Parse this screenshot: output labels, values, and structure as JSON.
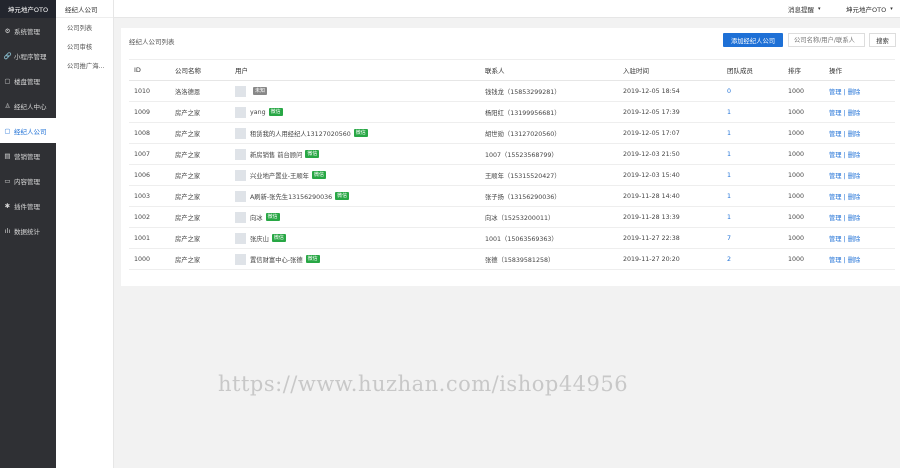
{
  "sidebar": {
    "brand": "坤元地产OTO",
    "items": [
      {
        "label": "系统管理",
        "icon": "gear-icon",
        "glyph": "⚙"
      },
      {
        "label": "小程序管理",
        "icon": "link-icon",
        "glyph": "🔗"
      },
      {
        "label": "楼盘管理",
        "icon": "building-icon",
        "glyph": "▢"
      },
      {
        "label": "经纪人中心",
        "icon": "user-icon",
        "glyph": "♙"
      },
      {
        "label": "经纪人公司",
        "icon": "company-icon",
        "glyph": "▢",
        "active": true
      },
      {
        "label": "营销管理",
        "icon": "marketing-icon",
        "glyph": "▤"
      },
      {
        "label": "内容管理",
        "icon": "content-icon",
        "glyph": "▭"
      },
      {
        "label": "插件管理",
        "icon": "plugin-icon",
        "glyph": "✱"
      },
      {
        "label": "数据统计",
        "icon": "chart-icon",
        "glyph": "ılı"
      }
    ]
  },
  "subnav": {
    "title": "经纪人公司",
    "items": [
      "公司列表",
      "公司审核",
      "公司推广海..."
    ]
  },
  "topbar": {
    "messages": "消息提醒",
    "account": "坤元地产OTO"
  },
  "panel": {
    "title": "经纪人公司列表",
    "add_button": "添加经纪人公司",
    "search_placeholder": "公司名称/用户/联系人",
    "search_button": "搜索"
  },
  "table": {
    "headers": [
      "ID",
      "公司名称",
      "用户",
      "联系人",
      "入驻时间",
      "团队成员",
      "排序",
      "操作"
    ],
    "rows": [
      {
        "id": "1010",
        "company": "洛洛德恩",
        "user": "",
        "badge": "未知",
        "contact": "钱钱龙（15853299281）",
        "time": "2019-12-05 18:54",
        "members": "0",
        "sort": "1000",
        "ops": "管理 | 删除"
      },
      {
        "id": "1009",
        "company": "房产之家",
        "user": "yang",
        "badge": "微信",
        "contact": "杨阳红（13199956681）",
        "time": "2019-12-05 17:39",
        "members": "1",
        "sort": "1000",
        "ops": "管理 | 删除"
      },
      {
        "id": "1008",
        "company": "房产之家",
        "user": "租赁我的人用经纪人13127020560",
        "badge": "微信",
        "contact": "胡世勋（13127020560）",
        "time": "2019-12-05 17:07",
        "members": "1",
        "sort": "1000",
        "ops": "管理 | 删除"
      },
      {
        "id": "1007",
        "company": "房产之家",
        "user": "新房销售 前台顾问",
        "badge": "微信",
        "contact": "1007（15523568799）",
        "time": "2019-12-03 21:50",
        "members": "1",
        "sort": "1000",
        "ops": "管理 | 删除"
      },
      {
        "id": "1006",
        "company": "房产之家",
        "user": "兴业地产置业-王顺年",
        "badge": "微信",
        "contact": "王顺年（15315520427）",
        "time": "2019-12-03 15:40",
        "members": "1",
        "sort": "1000",
        "ops": "管理 | 删除"
      },
      {
        "id": "1003",
        "company": "房产之家",
        "user": "A刷新-张先生13156290036",
        "badge": "微信",
        "contact": "张子扬（13156290036）",
        "time": "2019-11-28 14:40",
        "members": "1",
        "sort": "1000",
        "ops": "管理 | 删除"
      },
      {
        "id": "1002",
        "company": "房产之家",
        "user": "向冰",
        "badge": "微信",
        "contact": "向冰（15253200011）",
        "time": "2019-11-28 13:39",
        "members": "1",
        "sort": "1000",
        "ops": "管理 | 删除"
      },
      {
        "id": "1001",
        "company": "房产之家",
        "user": "张庆山",
        "badge": "微信",
        "contact": "1001（15063569363）",
        "time": "2019-11-27 22:38",
        "members": "7",
        "sort": "1000",
        "ops": "管理 | 删除"
      },
      {
        "id": "1000",
        "company": "房产之家",
        "user": "置信财富中心-张德",
        "badge": "微信",
        "contact": "张德（15839581258）",
        "time": "2019-11-27 20:20",
        "members": "2",
        "sort": "1000",
        "ops": "管理 | 删除"
      }
    ]
  },
  "watermark": "https://www.huzhan.com/ishop44956",
  "colors": {
    "accent": "#1e70d6",
    "sidebar_bg": "#2f3034",
    "badge_green": "#28a745"
  }
}
